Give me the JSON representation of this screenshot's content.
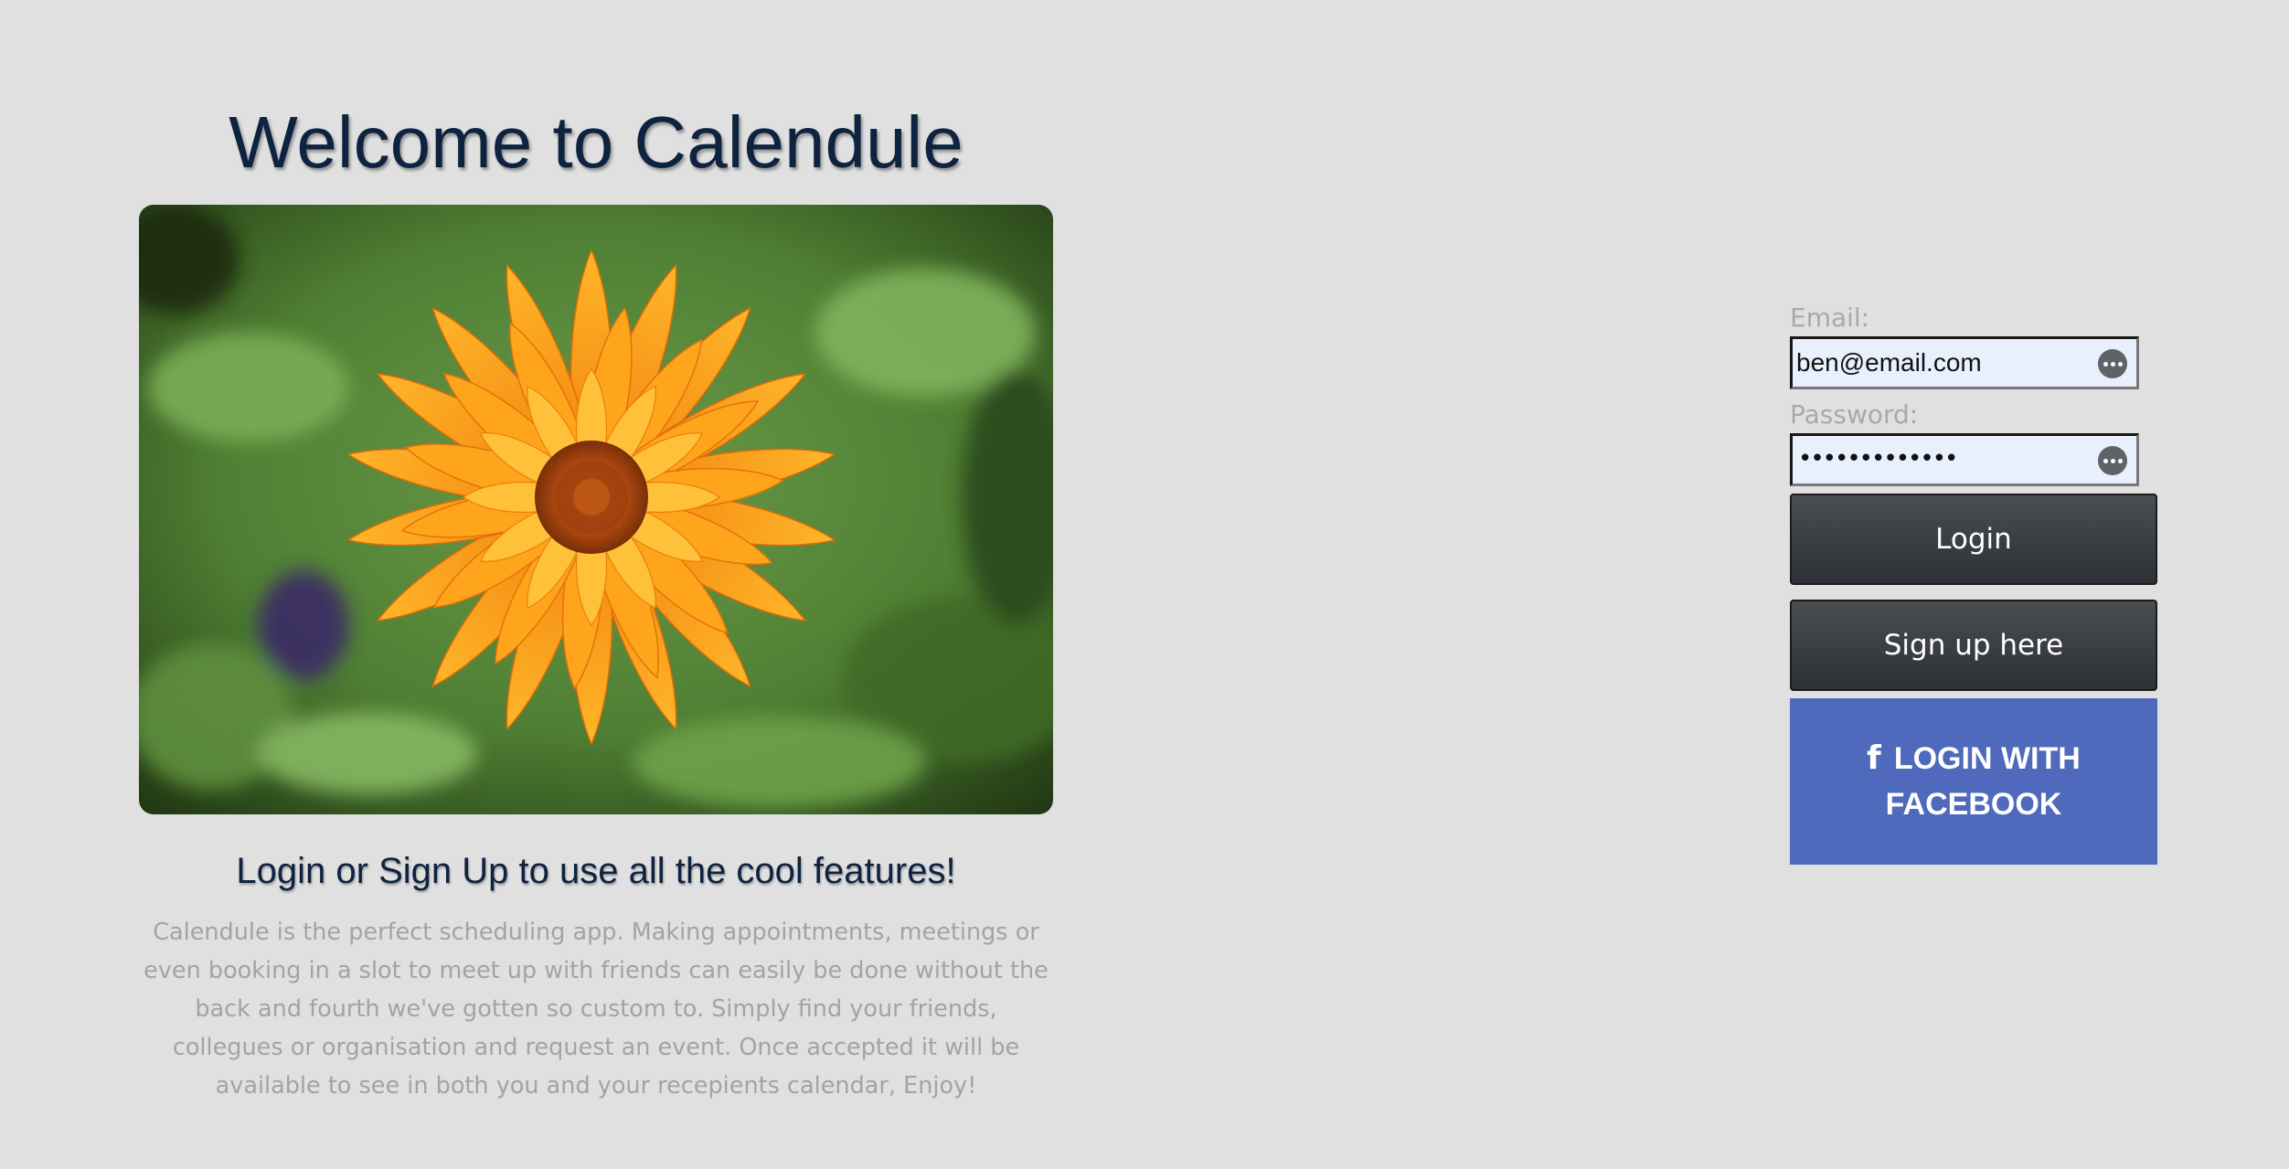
{
  "hero": {
    "title": "Welcome to Calendule",
    "image_alt": "orange-calendula-flower",
    "subtitle": "Login or Sign Up to use all the cool features!",
    "description": "Calendule is the perfect scheduling app. Making appointments, meetings or even booking in a slot to meet up with friends can easily be done without the back and fourth we've gotten so custom to. Simply find your friends, collegues or organisation and request an event. Once accepted it will be available to see in both you and your recepients calendar, Enjoy!"
  },
  "login_form": {
    "email_label": "Email:",
    "email_value": "ben@email.com",
    "password_label": "Password:",
    "password_display": "•••••••••••••",
    "login_button": "Login",
    "signup_button": "Sign up here",
    "facebook_icon": "f",
    "facebook_button": "LOGIN WITH FACEBOOK"
  },
  "colors": {
    "background": "#e0e0e0",
    "heading": "#0e2340",
    "muted_text": "#a3a3a3",
    "dark_button": "#3a3e43",
    "facebook_blue": "#4f69bd",
    "autofill_field": "#e8f0fe"
  }
}
